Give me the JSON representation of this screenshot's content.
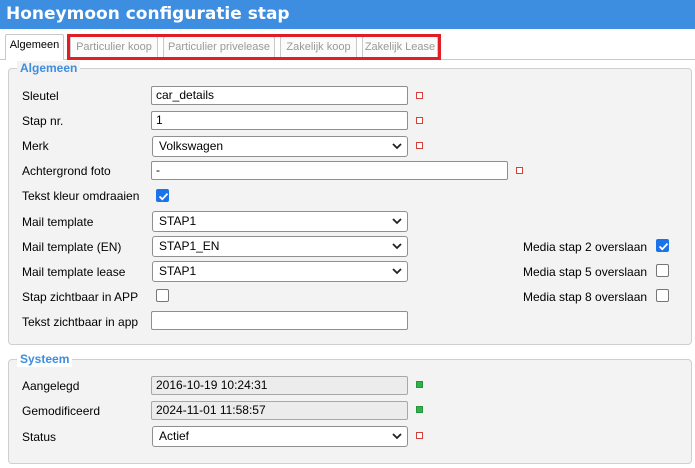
{
  "window": {
    "title": "Honeymoon configuratie stap"
  },
  "tabs": [
    {
      "label": "Algemeen",
      "active": true
    },
    {
      "label": "Particulier koop",
      "active": false
    },
    {
      "label": "Particulier privelease",
      "active": false
    },
    {
      "label": "Zakelijk koop",
      "active": false
    },
    {
      "label": "Zakelijk Lease",
      "active": false
    }
  ],
  "general": {
    "legend": "Algemeen",
    "key": {
      "label": "Sleutel",
      "value": "car_details"
    },
    "step_nr": {
      "label": "Stap nr.",
      "value": "1"
    },
    "brand": {
      "label": "Merk",
      "value": "Volkswagen"
    },
    "background_photo": {
      "label": "Achtergrond foto",
      "value": "-"
    },
    "invert_text_color": {
      "label": "Tekst kleur omdraaien",
      "checked": true
    },
    "mail_template": {
      "label": "Mail template",
      "value": "STAP1"
    },
    "mail_template_en": {
      "label": "Mail template (EN)",
      "value": "STAP1_EN"
    },
    "mail_template_lease": {
      "label": "Mail template lease",
      "value": "STAP1"
    },
    "step_visible_app": {
      "label": "Stap zichtbaar in APP",
      "checked": false
    },
    "text_visible_app": {
      "label": "Tekst zichtbaar in app",
      "value": ""
    },
    "skip_media_2": {
      "label": "Media stap 2 overslaan",
      "checked": true
    },
    "skip_media_5": {
      "label": "Media stap 5 overslaan",
      "checked": false
    },
    "skip_media_8": {
      "label": "Media stap 8 overslaan",
      "checked": false
    }
  },
  "system": {
    "legend": "Systeem",
    "created": {
      "label": "Aangelegd",
      "value": "2016-10-19 10:24:31"
    },
    "modified": {
      "label": "Gemodificeerd",
      "value": "2024-11-01 11:58:57"
    },
    "status": {
      "label": "Status",
      "value": "Actief"
    }
  },
  "colors": {
    "accent": "#3d8de0",
    "highlight": "#e01e25",
    "checkbox": "#1a73e8",
    "required_marker": "#d4403a",
    "ok_marker": "#2fb24a"
  }
}
